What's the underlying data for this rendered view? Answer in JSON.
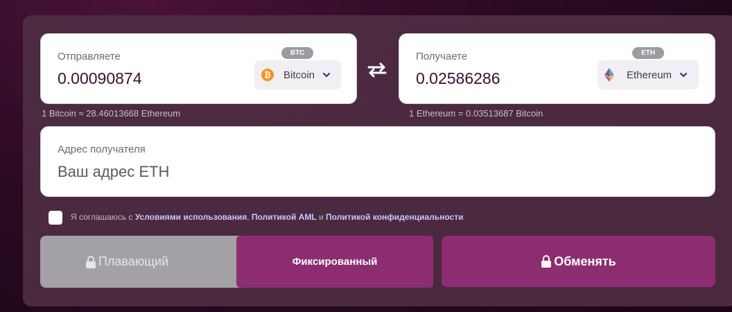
{
  "send": {
    "label": "Отправляете",
    "amount": "0.00090874",
    "coin": "Bitcoin",
    "ticker": "BTC",
    "coin_icon": "bitcoin-icon",
    "rate": "1 Bitcoin ≈ 28.46013668 Ethereum"
  },
  "receive": {
    "label": "Получаете",
    "amount": "0.02586286",
    "coin": "Ethereum",
    "ticker": "ETH",
    "coin_icon": "ethereum-icon",
    "rate": "1 Ethereum = 0.03513687 Bitcoin"
  },
  "address": {
    "label": "Адрес получателя",
    "placeholder": "Ваш адрес ETH"
  },
  "agreement": {
    "prefix": "Я соглашаюсь с ",
    "terms_link": "Условиями использования",
    "sep1": ", ",
    "aml_link": "Политикой AML",
    "sep2": " и ",
    "privacy_link": "Политикой конфиденциальности"
  },
  "rate_type": {
    "floating_label": "Плавающий",
    "fixed_label": "Фиксированный"
  },
  "exchange_button": "Обменять",
  "colors": {
    "accent": "#8c2d72",
    "disabled": "#a3a0a6",
    "bitcoin": "#f7931a",
    "value_text": "#3a1030"
  }
}
